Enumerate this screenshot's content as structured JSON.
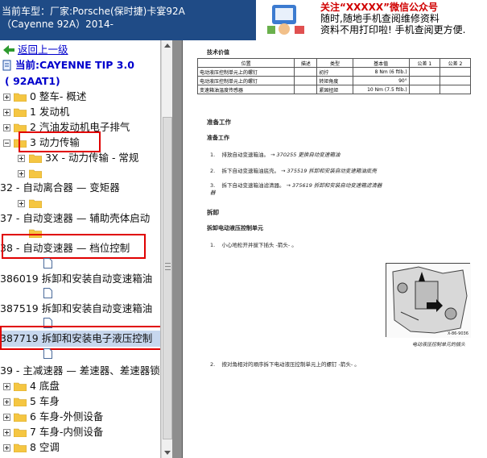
{
  "header": {
    "line1": "当前车型：厂家:Porsche(保时捷)卡宴92A",
    "line2": "（Cayenne 92A）2014-"
  },
  "ad": {
    "line0": "关注“XXXXX”微信公众号",
    "line1": "随时,随地手机查阅维修资料",
    "line2": "资料不用打印啦! 手机查阅更方便."
  },
  "tree": {
    "back": "返回上一级",
    "current_line1": "当前:CAYENNE TIP 3.0",
    "current_line2": "( 92AAT1)",
    "items": [
      "0 整车- 概述",
      "1 发动机",
      "2 汽油发动机电子排气",
      "3 动力传输",
      "3X - 动力传输 - 常规",
      "",
      "32 - 自动离合器 — 变矩器",
      "",
      "37 - 自动变速器 — 辅助壳体启动",
      "",
      "38 - 自动变速器 — 档位控制",
      "",
      "386019 拆卸和安装自动变速箱油",
      "387519 拆卸和安装自动变速箱油",
      "387719 拆卸和安装电子液压控制",
      "39 - 主减速器 — 差速器、差速器锁",
      "4 底盘",
      "5 车身",
      "6 车身-外侧设备",
      "7 车身-内侧设备",
      "8 空调"
    ]
  },
  "document": {
    "tech_title": "技术价值",
    "table": {
      "headers": [
        "位置",
        "描述",
        "类型",
        "基本值",
        "公差 1",
        "公差 2"
      ],
      "rows": [
        [
          "电动液压控制单元上的螺钉",
          "",
          "初拧",
          "8 Nm (6 ftlb.)",
          "",
          ""
        ],
        [
          "电动液压控制单元上的螺钉",
          "",
          "转矩角度",
          "90°",
          "",
          ""
        ],
        [
          "变速箱油温度传感器",
          "",
          "紧固扭矩",
          "10 Nm (7.5 ftlb.)",
          "",
          ""
        ]
      ]
    },
    "prep_title": "准备工作",
    "prep_sub": "准备工作",
    "prep_steps": [
      {
        "n": "1.",
        "text": "排放自动变速箱油。",
        "link": " → 370255 更换自动变速箱油"
      },
      {
        "n": "2.",
        "text": "拆下自动变速箱油底壳。",
        "link": " → 375519 拆卸和安装自动变速箱油底壳"
      },
      {
        "n": "3.",
        "text": "拆下自动变速箱油滤清器。",
        "link": " → 375619 拆卸和安装自动变速箱滤清器"
      }
    ],
    "prep_cont": "器",
    "remove_title": "拆卸",
    "remove_sub": "拆卸电动液压控制单元",
    "remove_step1": "小心地松开并拔下插头 -箭头- 。",
    "figure_id": "X-86-9036",
    "figure_caption": "电动液压控制单元的插头",
    "remove_step2": "按对角相对的顺序拆下电动液压控制单元上的螺钉 -箭头- 。",
    "step2_n": "2.",
    "step1_n": "1."
  },
  "colors": {
    "header_bg": "#1f4b86",
    "highlight": "#e00000",
    "link": "#0000cc",
    "selection": "#c7d7ee"
  }
}
